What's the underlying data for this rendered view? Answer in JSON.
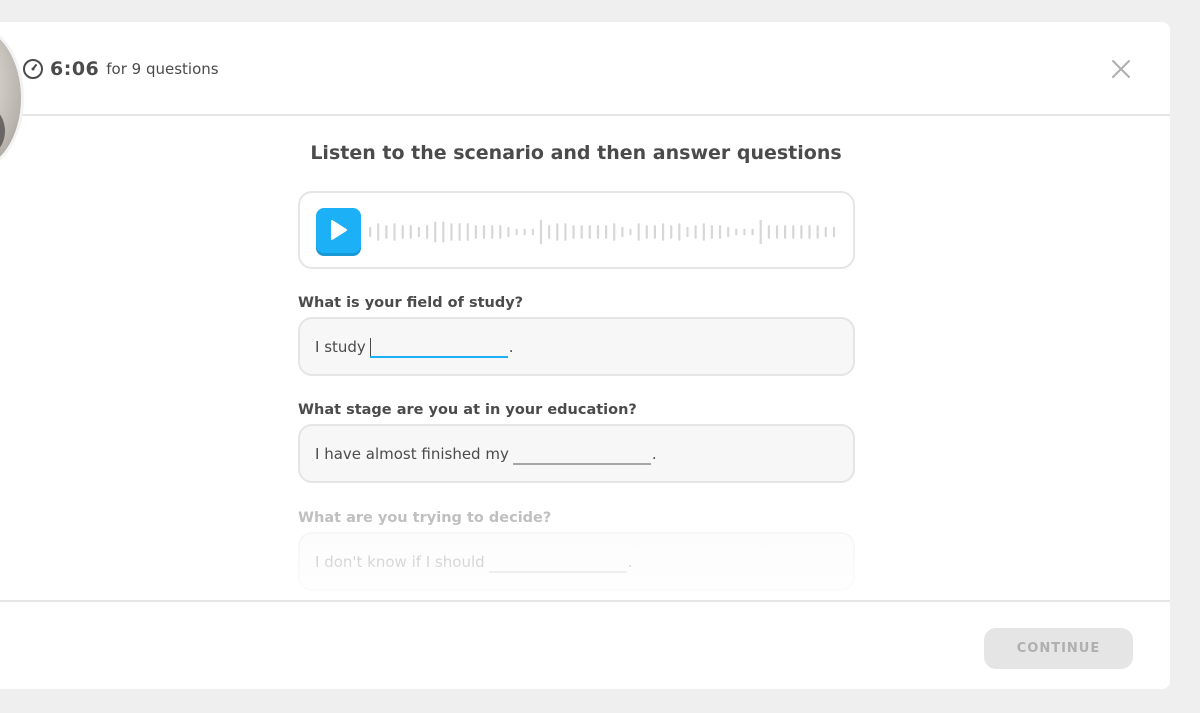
{
  "timer": {
    "value": "6:06",
    "suffix": "for 9 questions",
    "icon": "clock-icon"
  },
  "close": {
    "icon": "close-icon"
  },
  "title": "Listen to the scenario and then answer questions",
  "audio": {
    "play_icon": "play-icon",
    "accent": "#1cb0f6"
  },
  "questions": [
    {
      "label": "What is your field of study?",
      "prefix": "I study",
      "suffix": ".",
      "state": "active"
    },
    {
      "label": "What stage are you at in your education?",
      "prefix": "I have almost finished my",
      "suffix": ".",
      "state": "default"
    },
    {
      "label": "What are you trying to decide?",
      "prefix": "I don't know if I should",
      "suffix": ".",
      "state": "faded"
    }
  ],
  "footer": {
    "continue_label": "CONTINUE",
    "continue_state": "disabled"
  }
}
